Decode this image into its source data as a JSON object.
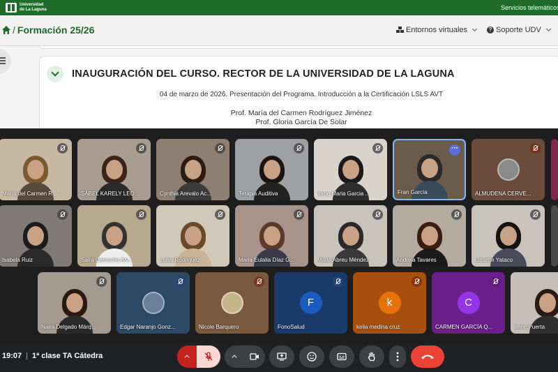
{
  "topbar": {
    "logo_line1": "Universidad",
    "logo_line2": "de La Laguna",
    "services": "Servicios telemáticos"
  },
  "navbar": {
    "separator": "/",
    "course": "Formación 25/26",
    "entornos": "Entornos virtuales",
    "soporte": "Soporte UDV"
  },
  "section": {
    "title": "INAUGURACIÓN DEL CURSO. RECTOR DE LA UNIVERSIDAD DE LA LAGUNA",
    "line1": "04 de marzo de 2026. Presentación del Programa. Introducción a la Certificación LSLS AVT",
    "line2": "Prof. María del Carmen Rodríguez Jiménez",
    "line3": "Prof. Gloria García De Solar"
  },
  "participants_row1": [
    {
      "name": "María del Carmen R...",
      "bg": "#c7b8a3",
      "hair": "#7a5a2e",
      "body": "#5a4a3a",
      "mic": "muted"
    },
    {
      "name": "SABEL KARELY LEO...",
      "bg": "#a89c8f",
      "hair": "#3a2418",
      "body": "#2a2a2a",
      "mic": "muted"
    },
    {
      "name": "Cynthia Arevalo Ac...",
      "bg": "#8f7f70",
      "hair": "#2b1d14",
      "body": "#3b3b3b",
      "mic": "muted"
    },
    {
      "name": "Terapia Auditiva",
      "bg": "#9ea0a3",
      "hair": "#1c1410",
      "body": "#222222",
      "mic": "muted"
    },
    {
      "name": "Irene Maria Garcia ...",
      "bg": "#d8d4cc",
      "hair": "#1a1a1a",
      "body": "#2e2e2e",
      "mic": "muted"
    },
    {
      "name": "Fran García",
      "bg": "#6b5b4a",
      "hair": "#2a2a2a",
      "body": "#394a5a",
      "mic": "more"
    },
    {
      "name": "ALMUDENA CERVE...",
      "bg": "#6b4b3b",
      "hair": "",
      "body": "",
      "mic": "red"
    }
  ],
  "participants_row2": [
    {
      "name": "Isabela Ruiz",
      "bg": "#7f7a78",
      "hair": "#1c1c1c",
      "body": "#2a2a2a",
      "mic": "muted"
    },
    {
      "name": "Saira Camacho Alv...",
      "bg": "#b9a890",
      "hair": "#333333",
      "body": "#ededed",
      "mic": "muted"
    },
    {
      "name": "Luisa Rodriguez",
      "bg": "#d1c8b8",
      "hair": "#6a4a2a",
      "body": "#c9b49a",
      "mic": "muted"
    },
    {
      "name": "Maria Eulalia Díaz G...",
      "bg": "#a8938a",
      "hair": "#5a3a2a",
      "body": "#3a3a4a",
      "mic": "muted"
    },
    {
      "name": "Maria Abreu Méndez",
      "bg": "#c8c4bc",
      "hair": "#2a2a2a",
      "body": "#3a3a3a",
      "mic": "muted"
    },
    {
      "name": "Andreia Tavares",
      "bg": "#b5aaa0",
      "hair": "#3a1e14",
      "body": "#1a1a1a",
      "mic": "muted"
    },
    {
      "name": "Lissette Yataco",
      "bg": "#c9c3bb",
      "hair": "#141414",
      "body": "#4a4a5a",
      "mic": "muted"
    }
  ],
  "participants_row3": [
    {
      "name": "Naira Delgado Márq...",
      "bg": "#a49a90",
      "hair": "#2a1a12",
      "body": "#2a2a2a",
      "mic": "muted",
      "type": "video"
    },
    {
      "name": "Edgar Naranjo Gonz...",
      "bg": "#2c4a66",
      "mic": "blue",
      "type": "photo",
      "avatar_bg": "#6a7f9a"
    },
    {
      "name": "Nicole Barquero",
      "bg": "#7a5a3e",
      "mic": "red",
      "type": "photo",
      "avatar_bg": "#c8b48a"
    },
    {
      "name": "FonoSalud",
      "bg": "#1a3a6a",
      "mic": "blue",
      "type": "letter",
      "letter": "F",
      "avatar_bg": "#1a5bbf"
    },
    {
      "name": "keila medina cruz",
      "bg": "#a8500f",
      "mic": "red",
      "type": "letter",
      "letter": "k",
      "avatar_bg": "#e8710a"
    },
    {
      "name": "CARMEN GARCÍA Q...",
      "bg": "#6a1f8a",
      "mic": "purple",
      "type": "letter",
      "letter": "C",
      "avatar_bg": "#9334e6"
    },
    {
      "name": "Irene Puerta",
      "bg": "#c4bfb8",
      "hair": "#2a1a12",
      "body": "#2e2e2e",
      "mic": "none",
      "type": "video"
    }
  ],
  "meeting": {
    "time": "19:07",
    "separator": "|",
    "title": "1ª clase TA Cátedra"
  },
  "controls": {
    "mic_options": "^",
    "camera_options": "^",
    "icons": [
      "caret-up-icon",
      "mic-off-icon",
      "caret-up-icon",
      "camera-icon",
      "present-icon",
      "emoji-icon",
      "captions-icon",
      "raise-hand-icon",
      "more-options-icon",
      "end-call-icon"
    ]
  },
  "colors": {
    "brand_green": "#1f6b2a",
    "meet_dark": "#202124",
    "end_call_red": "#ea4335"
  }
}
